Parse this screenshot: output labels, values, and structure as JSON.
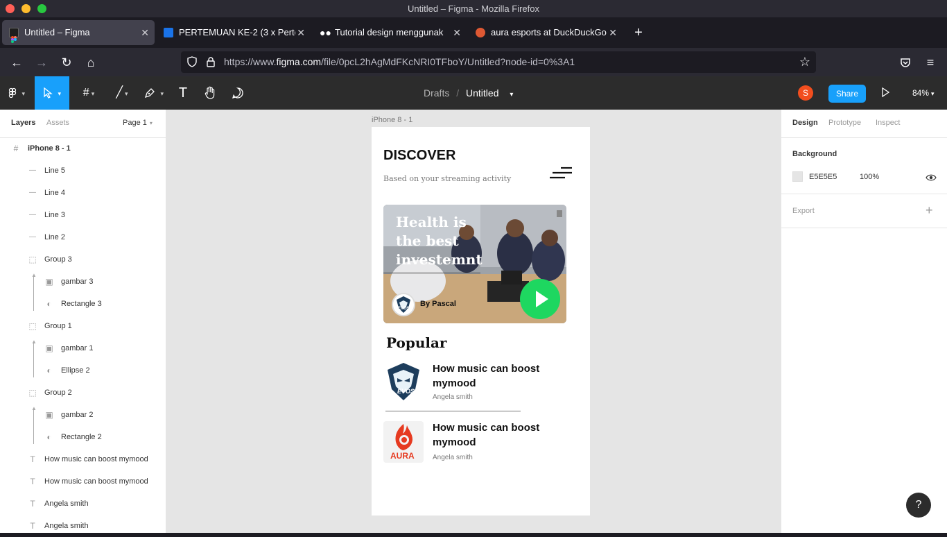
{
  "window": {
    "title": "Untitled – Figma - Mozilla Firefox"
  },
  "tabs": [
    {
      "label": "Untitled – Figma",
      "active": true,
      "icon": "figma-icon"
    },
    {
      "label": "PERTEMUAN KE-2 (3 x Perte",
      "active": false,
      "icon": "classroom-icon"
    },
    {
      "label": "Tutorial design menggunak",
      "active": false,
      "icon": "medium-icon"
    },
    {
      "label": "aura esports at DuckDuckGo",
      "active": false,
      "icon": "duckduckgo-icon"
    }
  ],
  "nav": {
    "url_prefix": "https://www.",
    "url_domain": "figma.com",
    "url_rest": "/file/0pcL2hAgMdFKcNRI0TFboY/Untitled?node-id=0%3A1"
  },
  "figma_toolbar": {
    "breadcrumb_root": "Drafts",
    "separator": "/",
    "file_name": "Untitled",
    "avatar_letter": "S",
    "share_label": "Share",
    "zoom": "84%"
  },
  "left_panel": {
    "tab_layers": "Layers",
    "tab_assets": "Assets",
    "page_label": "Page 1",
    "layers": [
      {
        "name": "iPhone 8 - 1",
        "icon": "frame-icon",
        "depth": 0,
        "bold": true
      },
      {
        "name": "Line 5",
        "icon": "line-icon",
        "depth": 1
      },
      {
        "name": "Line 4",
        "icon": "line-icon",
        "depth": 1
      },
      {
        "name": "Line 3",
        "icon": "line-icon",
        "depth": 1
      },
      {
        "name": "Line 2",
        "icon": "line-icon",
        "depth": 1
      },
      {
        "name": "Group 3",
        "icon": "group-icon",
        "depth": 1
      },
      {
        "name": "gambar 3",
        "icon": "image-icon",
        "depth": 2,
        "mask": true
      },
      {
        "name": "Rectangle 3",
        "icon": "mask-icon",
        "depth": 2
      },
      {
        "name": "Group 1",
        "icon": "group-icon",
        "depth": 1
      },
      {
        "name": "gambar 1",
        "icon": "image-icon",
        "depth": 2,
        "mask": true
      },
      {
        "name": "Ellipse 2",
        "icon": "mask-icon",
        "depth": 2
      },
      {
        "name": "Group 2",
        "icon": "group-icon",
        "depth": 1
      },
      {
        "name": "gambar 2",
        "icon": "image-icon",
        "depth": 2,
        "mask": true
      },
      {
        "name": "Rectangle 2",
        "icon": "mask-icon",
        "depth": 2
      },
      {
        "name": "How music can boost mymood",
        "icon": "text-icon",
        "depth": 1
      },
      {
        "name": "How music can boost mymood",
        "icon": "text-icon",
        "depth": 1
      },
      {
        "name": "Angela smith",
        "icon": "text-icon",
        "depth": 1
      },
      {
        "name": "Angela smith",
        "icon": "text-icon",
        "depth": 1
      }
    ]
  },
  "canvas": {
    "frame_label": "iPhone 8 - 1",
    "app": {
      "heading": "DISCOVER",
      "subheading": "Based on your streaming activity",
      "hero_title_1": "Health is",
      "hero_title_2": "the best",
      "hero_title_3": "investemnt",
      "hero_author": "By Pascal",
      "hero_logo_text": "EVOS",
      "popular_title": "Popular",
      "items": [
        {
          "title_1": "How music can boost",
          "title_2": "mymood",
          "author": "Angela smith",
          "logo": "EVOS"
        },
        {
          "title_1": "How music can boost",
          "title_2": "mymood",
          "author": "Angela smith",
          "logo": "AURA"
        }
      ]
    }
  },
  "right_panel": {
    "tab_design": "Design",
    "tab_prototype": "Prototype",
    "tab_inspect": "Inspect",
    "background_title": "Background",
    "bg_hex": "E5E5E5",
    "bg_opacity": "100%",
    "export_title": "Export",
    "help_label": "?"
  },
  "colors": {
    "figma_blue": "#18a0fb",
    "play_green": "#1ed760",
    "avatar_orange": "#f24e1e",
    "canvas_bg": "#e5e5e5"
  }
}
